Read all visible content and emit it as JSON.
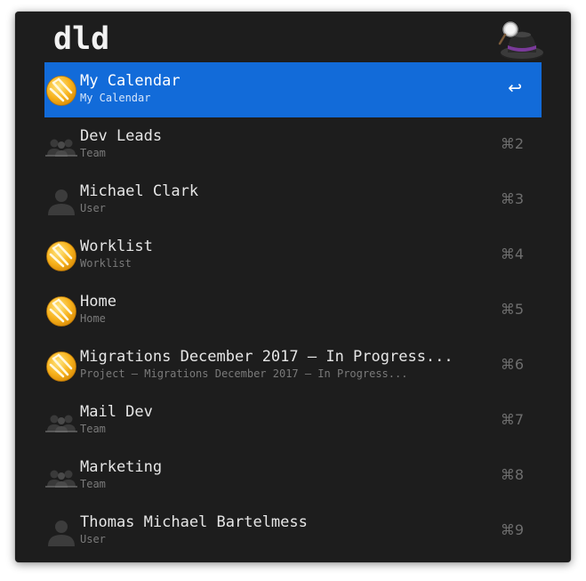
{
  "query": "dld",
  "results": [
    {
      "title": "My Calendar",
      "subtitle": "My Calendar",
      "shortcut": "↩",
      "icon": "project-ball-icon",
      "selected": true
    },
    {
      "title": "Dev Leads",
      "subtitle": "Team",
      "shortcut": "⌘2",
      "icon": "team-icon",
      "selected": false
    },
    {
      "title": "Michael Clark",
      "subtitle": "User",
      "shortcut": "⌘3",
      "icon": "user-icon",
      "selected": false
    },
    {
      "title": "Worklist",
      "subtitle": "Worklist",
      "shortcut": "⌘4",
      "icon": "project-ball-icon",
      "selected": false
    },
    {
      "title": "Home",
      "subtitle": "Home",
      "shortcut": "⌘5",
      "icon": "project-ball-icon",
      "selected": false
    },
    {
      "title": "Migrations December 2017 – In Progress...",
      "subtitle": "Project – Migrations December 2017 – In Progress...",
      "shortcut": "⌘6",
      "icon": "project-ball-icon",
      "selected": false
    },
    {
      "title": "Mail Dev",
      "subtitle": "Team",
      "shortcut": "⌘7",
      "icon": "team-icon",
      "selected": false
    },
    {
      "title": "Marketing",
      "subtitle": "Team",
      "shortcut": "⌘8",
      "icon": "team-icon",
      "selected": false
    },
    {
      "title": "Thomas Michael Bartelmess",
      "subtitle": "User",
      "shortcut": "⌘9",
      "icon": "user-icon",
      "selected": false
    }
  ],
  "colors": {
    "window_bg": "#1d1d1d",
    "selection": "#126bd9",
    "title_text": "#e6e6e6",
    "subtitle_text": "#7a7a7a",
    "shortcut_text": "#6e6e6e"
  }
}
